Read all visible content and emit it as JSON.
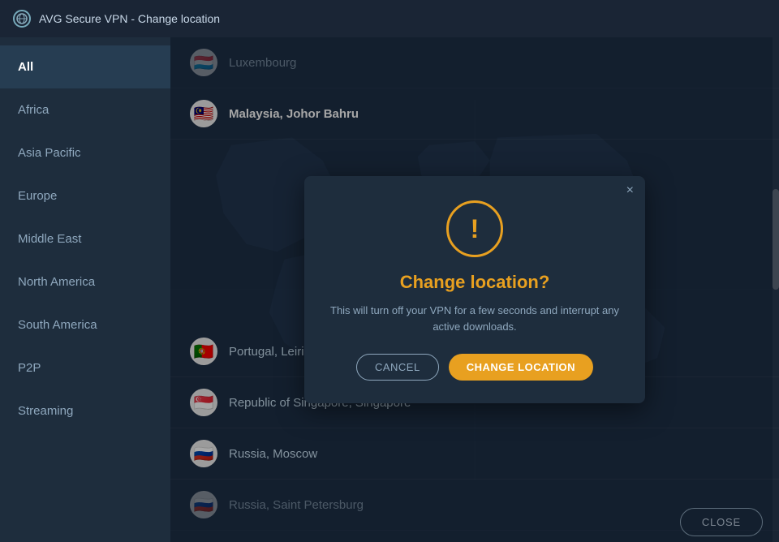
{
  "titleBar": {
    "title": "AVG Secure VPN - Change location",
    "icon": "vpn-icon"
  },
  "sidebar": {
    "items": [
      {
        "id": "all",
        "label": "All",
        "active": true
      },
      {
        "id": "africa",
        "label": "Africa",
        "active": false
      },
      {
        "id": "asia-pacific",
        "label": "Asia Pacific",
        "active": false
      },
      {
        "id": "europe",
        "label": "Europe",
        "active": false
      },
      {
        "id": "middle-east",
        "label": "Middle East",
        "active": false
      },
      {
        "id": "north-america",
        "label": "North America",
        "active": false
      },
      {
        "id": "south-america",
        "label": "South America",
        "active": false
      },
      {
        "id": "p2p",
        "label": "P2P",
        "active": false
      },
      {
        "id": "streaming",
        "label": "Streaming",
        "active": false
      }
    ]
  },
  "locationList": {
    "items": [
      {
        "id": "lu",
        "name": "Luxembourg",
        "flag": "🇱🇺",
        "bold": false,
        "dimmed": true
      },
      {
        "id": "my",
        "name": "Malaysia, Johor Bahru",
        "flag": "🇲🇾",
        "bold": true,
        "dimmed": false
      },
      {
        "id": "pt",
        "name": "Portugal, Leiria",
        "flag": "🇵🇹",
        "bold": false,
        "dimmed": false
      },
      {
        "id": "sg",
        "name": "Republic of Singapore, Singapore",
        "flag": "🇸🇬",
        "bold": false,
        "dimmed": false
      },
      {
        "id": "ru",
        "name": "Russia, Moscow",
        "flag": "🇷🇺",
        "bold": false,
        "dimmed": false
      },
      {
        "id": "ru2",
        "name": "Russia, Saint Petersburg",
        "flag": "🇷🇺",
        "bold": false,
        "dimmed": true
      }
    ]
  },
  "modal": {
    "title": "Change location?",
    "description": "This will turn off your VPN for a few seconds and interrupt any active downloads.",
    "cancelLabel": "CANCEL",
    "confirmLabel": "CHANGE LOCATION",
    "closeLabel": "×"
  },
  "footer": {
    "closeLabel": "CLOSE"
  }
}
